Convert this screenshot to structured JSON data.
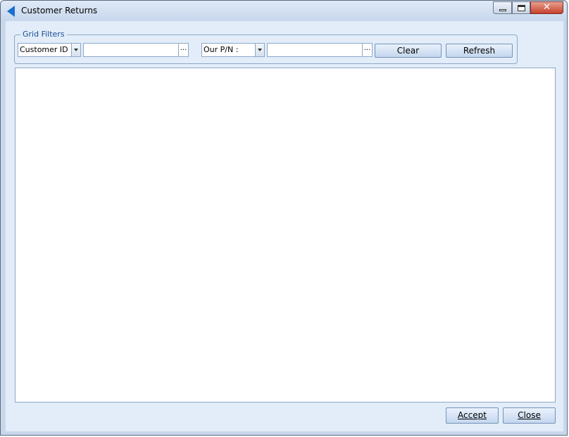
{
  "window": {
    "title": "Customer Returns"
  },
  "filters": {
    "legend": "Grid Filters",
    "filter1": {
      "field": "Customer ID :",
      "value": "",
      "browse": "..."
    },
    "filter2": {
      "field": "Our P/N :",
      "value": "",
      "browse": "..."
    },
    "clear_label": "Clear",
    "refresh_label": "Refresh"
  },
  "footer": {
    "accept_label": "Accept",
    "close_label": "Close"
  },
  "controls": {
    "close_glyph": "✕"
  },
  "icons": {
    "app": "back-arrow-icon",
    "minimize": "minimize-icon",
    "maximize": "maximize-icon",
    "close": "close-icon"
  },
  "colors": {
    "accent": "#1a6fd1",
    "close_button": "#c7402a",
    "client_background": "#e2edf9"
  }
}
